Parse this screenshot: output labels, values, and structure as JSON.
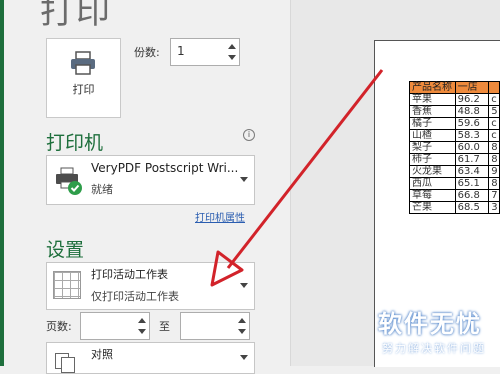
{
  "title": "打印",
  "print_button": {
    "label": "打印"
  },
  "copies": {
    "label": "份数:",
    "value": "1"
  },
  "printer": {
    "heading": "打印机",
    "info_icon": "i",
    "name": "VeryPDF Postscript Wri...",
    "status": "就绪",
    "properties_link": "打印机属性"
  },
  "settings": {
    "heading": "设置",
    "scope_title": "打印活动工作表",
    "scope_desc": "仅打印活动工作表",
    "pages_label": "页数:",
    "to_label": "至",
    "collate_label": "对照"
  },
  "preview": {
    "headers": [
      "产品名称",
      "一店",
      ""
    ],
    "rows": [
      [
        "苹果",
        "96.2",
        "c"
      ],
      [
        "香蕉",
        "48.8",
        "5"
      ],
      [
        "橘子",
        "59.6",
        "c"
      ],
      [
        "山楂",
        "58.3",
        "c"
      ],
      [
        "梨子",
        "60.0",
        "8"
      ],
      [
        "柿子",
        "61.7",
        "8"
      ],
      [
        "火龙果",
        "63.4",
        "9"
      ],
      [
        "西瓜",
        "65.1",
        "8"
      ],
      [
        "草莓",
        "66.8",
        "7"
      ],
      [
        "芒果",
        "68.5",
        "3"
      ]
    ]
  },
  "watermark": {
    "brand": "软件无忧",
    "tagline": "努力解决软件问题"
  },
  "colors": {
    "accent": "#1e6f3c",
    "header_fill": "#ee8a3c",
    "arrow": "#d2232a"
  }
}
